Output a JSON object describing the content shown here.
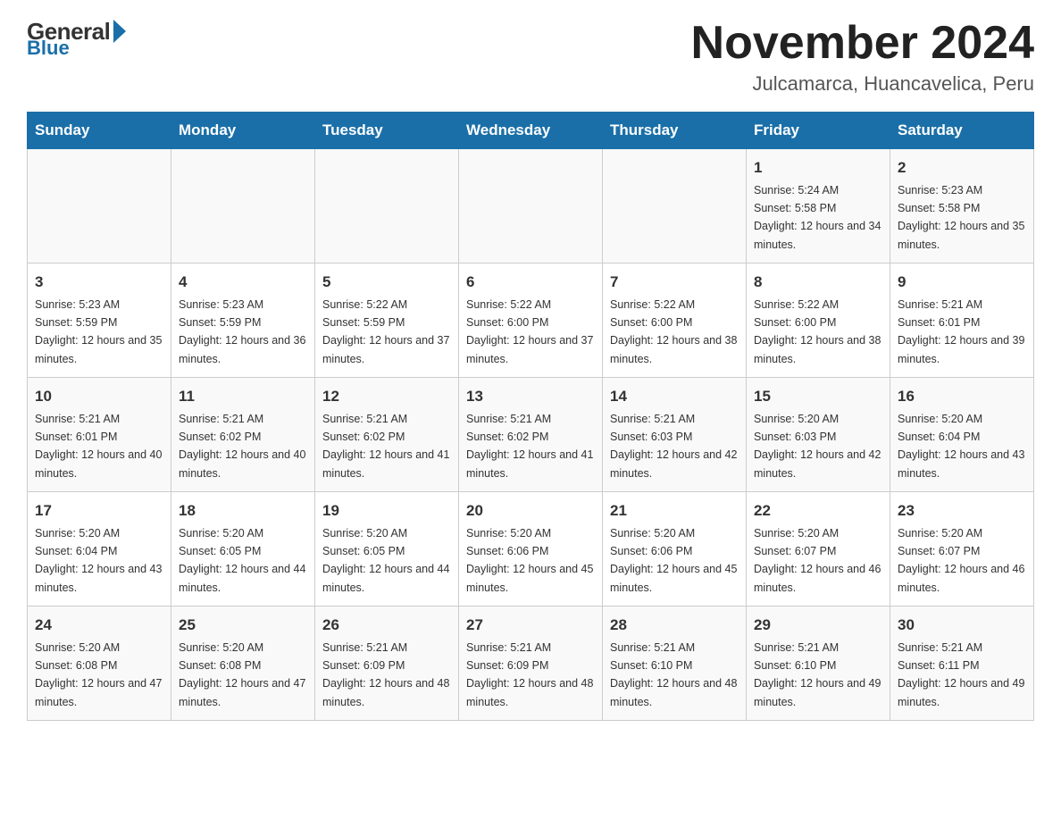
{
  "logo": {
    "general": "General",
    "blue": "Blue"
  },
  "title": "November 2024",
  "subtitle": "Julcamarca, Huancavelica, Peru",
  "days_of_week": [
    "Sunday",
    "Monday",
    "Tuesday",
    "Wednesday",
    "Thursday",
    "Friday",
    "Saturday"
  ],
  "weeks": [
    [
      {
        "day": "",
        "sunrise": "",
        "sunset": "",
        "daylight": ""
      },
      {
        "day": "",
        "sunrise": "",
        "sunset": "",
        "daylight": ""
      },
      {
        "day": "",
        "sunrise": "",
        "sunset": "",
        "daylight": ""
      },
      {
        "day": "",
        "sunrise": "",
        "sunset": "",
        "daylight": ""
      },
      {
        "day": "",
        "sunrise": "",
        "sunset": "",
        "daylight": ""
      },
      {
        "day": "1",
        "sunrise": "Sunrise: 5:24 AM",
        "sunset": "Sunset: 5:58 PM",
        "daylight": "Daylight: 12 hours and 34 minutes."
      },
      {
        "day": "2",
        "sunrise": "Sunrise: 5:23 AM",
        "sunset": "Sunset: 5:58 PM",
        "daylight": "Daylight: 12 hours and 35 minutes."
      }
    ],
    [
      {
        "day": "3",
        "sunrise": "Sunrise: 5:23 AM",
        "sunset": "Sunset: 5:59 PM",
        "daylight": "Daylight: 12 hours and 35 minutes."
      },
      {
        "day": "4",
        "sunrise": "Sunrise: 5:23 AM",
        "sunset": "Sunset: 5:59 PM",
        "daylight": "Daylight: 12 hours and 36 minutes."
      },
      {
        "day": "5",
        "sunrise": "Sunrise: 5:22 AM",
        "sunset": "Sunset: 5:59 PM",
        "daylight": "Daylight: 12 hours and 37 minutes."
      },
      {
        "day": "6",
        "sunrise": "Sunrise: 5:22 AM",
        "sunset": "Sunset: 6:00 PM",
        "daylight": "Daylight: 12 hours and 37 minutes."
      },
      {
        "day": "7",
        "sunrise": "Sunrise: 5:22 AM",
        "sunset": "Sunset: 6:00 PM",
        "daylight": "Daylight: 12 hours and 38 minutes."
      },
      {
        "day": "8",
        "sunrise": "Sunrise: 5:22 AM",
        "sunset": "Sunset: 6:00 PM",
        "daylight": "Daylight: 12 hours and 38 minutes."
      },
      {
        "day": "9",
        "sunrise": "Sunrise: 5:21 AM",
        "sunset": "Sunset: 6:01 PM",
        "daylight": "Daylight: 12 hours and 39 minutes."
      }
    ],
    [
      {
        "day": "10",
        "sunrise": "Sunrise: 5:21 AM",
        "sunset": "Sunset: 6:01 PM",
        "daylight": "Daylight: 12 hours and 40 minutes."
      },
      {
        "day": "11",
        "sunrise": "Sunrise: 5:21 AM",
        "sunset": "Sunset: 6:02 PM",
        "daylight": "Daylight: 12 hours and 40 minutes."
      },
      {
        "day": "12",
        "sunrise": "Sunrise: 5:21 AM",
        "sunset": "Sunset: 6:02 PM",
        "daylight": "Daylight: 12 hours and 41 minutes."
      },
      {
        "day": "13",
        "sunrise": "Sunrise: 5:21 AM",
        "sunset": "Sunset: 6:02 PM",
        "daylight": "Daylight: 12 hours and 41 minutes."
      },
      {
        "day": "14",
        "sunrise": "Sunrise: 5:21 AM",
        "sunset": "Sunset: 6:03 PM",
        "daylight": "Daylight: 12 hours and 42 minutes."
      },
      {
        "day": "15",
        "sunrise": "Sunrise: 5:20 AM",
        "sunset": "Sunset: 6:03 PM",
        "daylight": "Daylight: 12 hours and 42 minutes."
      },
      {
        "day": "16",
        "sunrise": "Sunrise: 5:20 AM",
        "sunset": "Sunset: 6:04 PM",
        "daylight": "Daylight: 12 hours and 43 minutes."
      }
    ],
    [
      {
        "day": "17",
        "sunrise": "Sunrise: 5:20 AM",
        "sunset": "Sunset: 6:04 PM",
        "daylight": "Daylight: 12 hours and 43 minutes."
      },
      {
        "day": "18",
        "sunrise": "Sunrise: 5:20 AM",
        "sunset": "Sunset: 6:05 PM",
        "daylight": "Daylight: 12 hours and 44 minutes."
      },
      {
        "day": "19",
        "sunrise": "Sunrise: 5:20 AM",
        "sunset": "Sunset: 6:05 PM",
        "daylight": "Daylight: 12 hours and 44 minutes."
      },
      {
        "day": "20",
        "sunrise": "Sunrise: 5:20 AM",
        "sunset": "Sunset: 6:06 PM",
        "daylight": "Daylight: 12 hours and 45 minutes."
      },
      {
        "day": "21",
        "sunrise": "Sunrise: 5:20 AM",
        "sunset": "Sunset: 6:06 PM",
        "daylight": "Daylight: 12 hours and 45 minutes."
      },
      {
        "day": "22",
        "sunrise": "Sunrise: 5:20 AM",
        "sunset": "Sunset: 6:07 PM",
        "daylight": "Daylight: 12 hours and 46 minutes."
      },
      {
        "day": "23",
        "sunrise": "Sunrise: 5:20 AM",
        "sunset": "Sunset: 6:07 PM",
        "daylight": "Daylight: 12 hours and 46 minutes."
      }
    ],
    [
      {
        "day": "24",
        "sunrise": "Sunrise: 5:20 AM",
        "sunset": "Sunset: 6:08 PM",
        "daylight": "Daylight: 12 hours and 47 minutes."
      },
      {
        "day": "25",
        "sunrise": "Sunrise: 5:20 AM",
        "sunset": "Sunset: 6:08 PM",
        "daylight": "Daylight: 12 hours and 47 minutes."
      },
      {
        "day": "26",
        "sunrise": "Sunrise: 5:21 AM",
        "sunset": "Sunset: 6:09 PM",
        "daylight": "Daylight: 12 hours and 48 minutes."
      },
      {
        "day": "27",
        "sunrise": "Sunrise: 5:21 AM",
        "sunset": "Sunset: 6:09 PM",
        "daylight": "Daylight: 12 hours and 48 minutes."
      },
      {
        "day": "28",
        "sunrise": "Sunrise: 5:21 AM",
        "sunset": "Sunset: 6:10 PM",
        "daylight": "Daylight: 12 hours and 48 minutes."
      },
      {
        "day": "29",
        "sunrise": "Sunrise: 5:21 AM",
        "sunset": "Sunset: 6:10 PM",
        "daylight": "Daylight: 12 hours and 49 minutes."
      },
      {
        "day": "30",
        "sunrise": "Sunrise: 5:21 AM",
        "sunset": "Sunset: 6:11 PM",
        "daylight": "Daylight: 12 hours and 49 minutes."
      }
    ]
  ]
}
